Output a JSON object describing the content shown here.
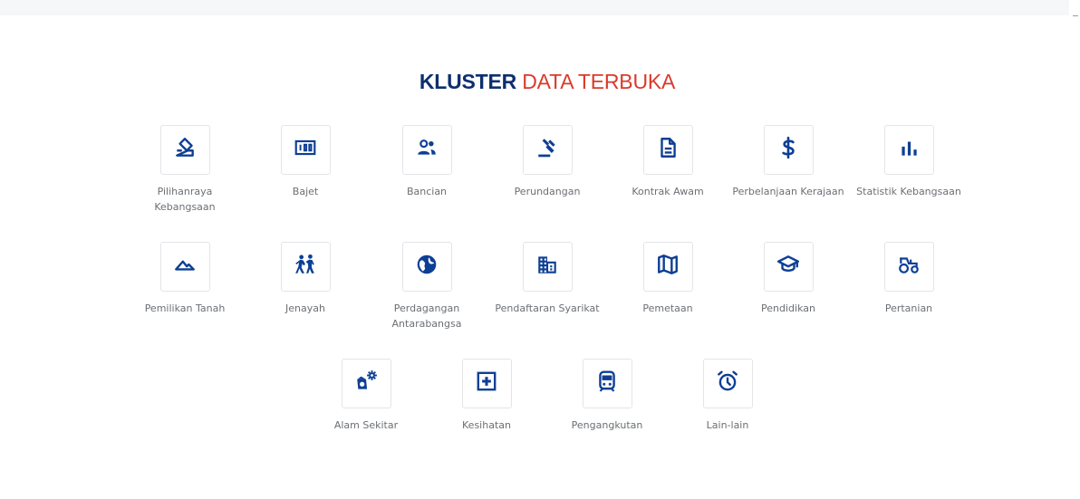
{
  "title": {
    "part1": "KLUSTER",
    "part2": "DATA TERBUKA"
  },
  "colors": {
    "title_dark": "#0d2f6e",
    "title_red": "#d93a2b",
    "icon": "#0d3f94"
  },
  "clusters": [
    {
      "label": "Pilihanraya Kebangsaan",
      "icon": "ballot-icon"
    },
    {
      "label": "Bajet",
      "icon": "money-icon"
    },
    {
      "label": "Bancian",
      "icon": "people-icon"
    },
    {
      "label": "Perundangan",
      "icon": "gavel-icon"
    },
    {
      "label": "Kontrak Awam",
      "icon": "document-icon"
    },
    {
      "label": "Perbelanjaan Kerajaan",
      "icon": "dollar-icon"
    },
    {
      "label": "Statistik Kebangsaan",
      "icon": "bar-chart-icon"
    },
    {
      "label": "Pemilikan Tanah",
      "icon": "landscape-icon"
    },
    {
      "label": "Jenayah",
      "icon": "crime-icon"
    },
    {
      "label": "Perdagangan Antarabangsa",
      "icon": "globe-icon"
    },
    {
      "label": "Pendaftaran Syarikat",
      "icon": "building-icon"
    },
    {
      "label": "Pemetaan",
      "icon": "map-icon"
    },
    {
      "label": "Pendidikan",
      "icon": "graduation-cap-icon"
    },
    {
      "label": "Pertanian",
      "icon": "tractor-icon"
    },
    {
      "label": "Alam Sekitar",
      "icon": "nature-icon"
    },
    {
      "label": "Kesihatan",
      "icon": "medical-plus-icon"
    },
    {
      "label": "Pengangkutan",
      "icon": "train-icon"
    },
    {
      "label": "Lain-lain",
      "icon": "alarm-clock-icon"
    }
  ]
}
